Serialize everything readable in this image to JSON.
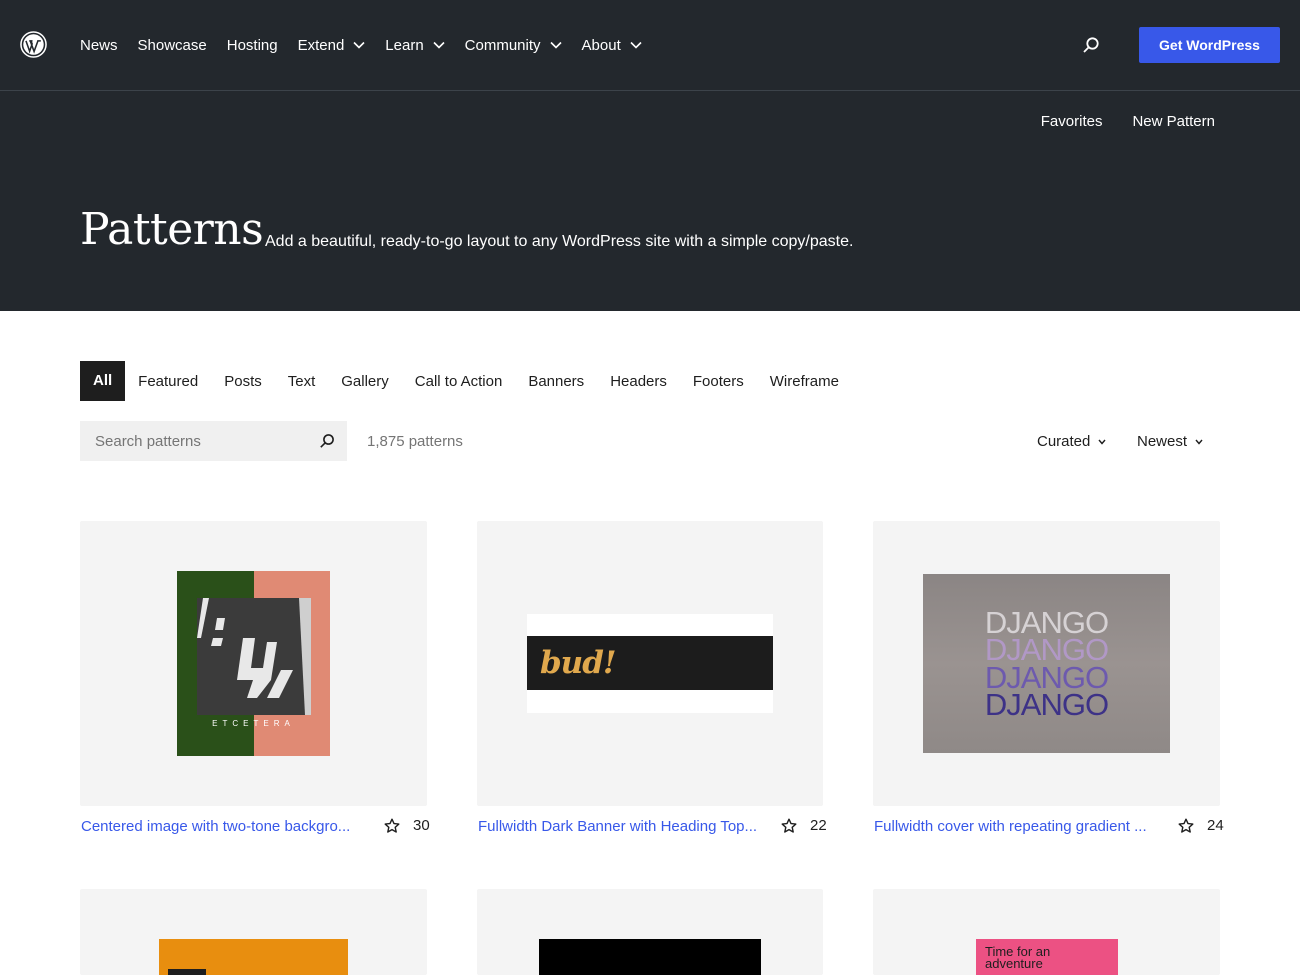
{
  "header": {
    "nav": [
      {
        "label": "News",
        "dropdown": false
      },
      {
        "label": "Showcase",
        "dropdown": false
      },
      {
        "label": "Hosting",
        "dropdown": false
      },
      {
        "label": "Extend",
        "dropdown": true
      },
      {
        "label": "Learn",
        "dropdown": true
      },
      {
        "label": "Community",
        "dropdown": true
      },
      {
        "label": "About",
        "dropdown": true
      }
    ],
    "cta_label": "Get WordPress"
  },
  "hero": {
    "subnav": [
      "Favorites",
      "New Pattern"
    ],
    "title": "Patterns",
    "tagline": "Add a beautiful, ready-to-go layout to any WordPress site with a simple copy/paste."
  },
  "categories": {
    "active": "All",
    "items": [
      "All",
      "Featured",
      "Posts",
      "Text",
      "Gallery",
      "Call to Action",
      "Banners",
      "Headers",
      "Footers",
      "Wireframe"
    ]
  },
  "filters": {
    "search_placeholder": "Search patterns",
    "count": "1,875 patterns",
    "curation": "Curated",
    "sort": "Newest"
  },
  "patterns": [
    {
      "title": "Centered image with two-tone backgro...",
      "favorites": "30",
      "preview_word": "ETCETERA"
    },
    {
      "title": "Fullwidth Dark Banner with Heading Top...",
      "favorites": "22",
      "preview_word": "bud!"
    },
    {
      "title": "Fullwidth cover with repeating gradient ...",
      "favorites": "24",
      "preview_word": "DJANGO"
    },
    {
      "title": "",
      "favorites": "",
      "preview_word": ""
    },
    {
      "title": "",
      "favorites": "",
      "preview_word": ""
    },
    {
      "title": "",
      "favorites": "",
      "preview_word": "Time for an adventure"
    }
  ],
  "colors": {
    "header_bg": "#23282d",
    "accent": "#3858e9",
    "card_bg": "#f4f4f4"
  }
}
